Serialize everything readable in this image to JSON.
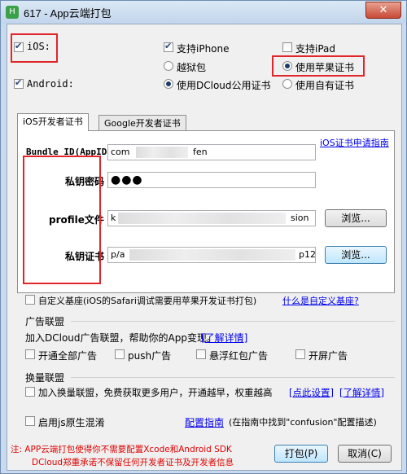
{
  "window": {
    "title": "617 - App云端打包",
    "icon": "hbuilder-icon",
    "close": "✕"
  },
  "platforms": {
    "ios_label": "iOS:",
    "android_label": "Android:",
    "support_iphone": "支持iPhone",
    "support_ipad": "支持iPad",
    "jailbreak": "越狱包",
    "use_apple_cert": "使用苹果证书",
    "use_dcloud_cert": "使用DCloud公用证书",
    "use_own_cert": "使用自有证书"
  },
  "tabs": {
    "ios": "iOS开发者证书",
    "google": "Google开发者证书"
  },
  "ios_cert": {
    "apply_link": "iOS证书申请指南",
    "bundle_label": "Bundle ID(AppID)",
    "bundle_value_start": "com",
    "bundle_value_end": "fen",
    "password_label": "私钥密码",
    "password_value": "●●●",
    "profile_label": "profile文件",
    "profile_value_start": "k",
    "profile_value_end": "sion",
    "cert_label": "私钥证书",
    "cert_value_start": "p/a",
    "cert_value_end": "p12",
    "browse1": "浏览...",
    "browse2": "浏览..."
  },
  "custom_base": {
    "label": "自定义基座(iOS的Safari调试需要用苹果开发证书打包)",
    "link": "什么是自定义基座?"
  },
  "ad": {
    "title": "广告联盟",
    "desc": "加入DCloud广告联盟，帮助你的App变现。",
    "desc_link": "[了解详情]",
    "all_ads": "开通全部广告",
    "push_ads": "push广告",
    "float_ads": "悬浮红包广告",
    "splash_ads": "开屏广告"
  },
  "swap": {
    "title": "换量联盟",
    "label": "加入换量联盟，免费获取更多用户，开通越早，权重越高",
    "settings_link": "[点此设置]",
    "detail_link": "[了解详情]"
  },
  "js": {
    "label": "启用js原生混淆",
    "guide_link": "配置指南",
    "hint": "(在指南中找到\"confusion\"配置描述)"
  },
  "footer": {
    "note1": "注: APP云端打包使得你不需要配置Xcode和Android SDK",
    "note2": "DCloud郑重承诺不保留任何开发者证书及开发者信息",
    "pack": "打包(P)",
    "cancel": "取消(C)"
  },
  "colors": {
    "highlight": "#e0262b",
    "link": "#0000ee",
    "note": "#e00000"
  }
}
